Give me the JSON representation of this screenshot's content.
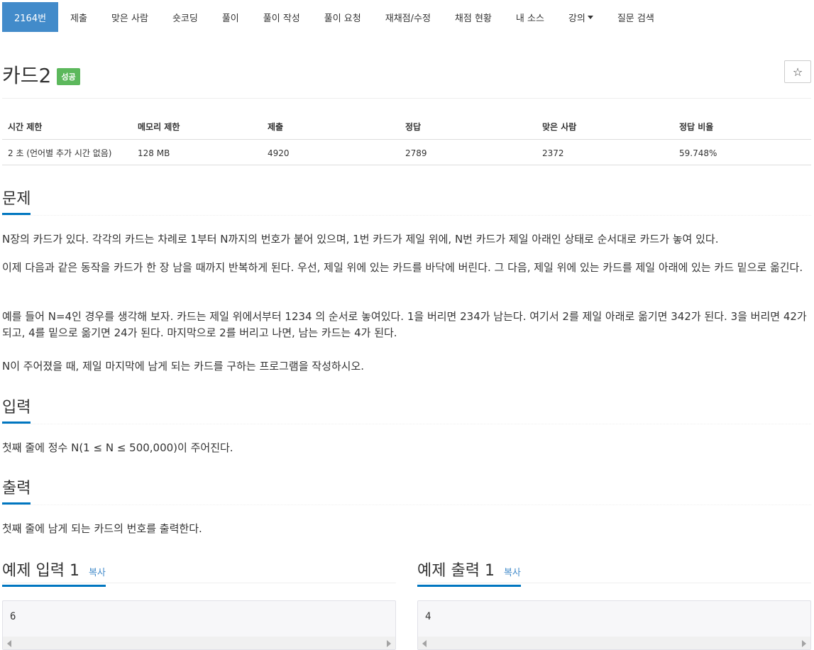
{
  "nav": [
    {
      "label": "2164번",
      "active": true
    },
    {
      "label": "제출"
    },
    {
      "label": "맞은 사람"
    },
    {
      "label": "숏코딩"
    },
    {
      "label": "풀이"
    },
    {
      "label": "풀이 작성"
    },
    {
      "label": "풀이 요청"
    },
    {
      "label": "재채점/수정"
    },
    {
      "label": "채점 현황"
    },
    {
      "label": "내 소스"
    },
    {
      "label": "강의"
    },
    {
      "label": "질문 검색"
    }
  ],
  "problem": {
    "title": "카드2",
    "status_badge": "성공",
    "star_icon": "☆"
  },
  "info": {
    "headers": [
      "시간 제한",
      "메모리 제한",
      "제출",
      "정답",
      "맞은 사람",
      "정답 비율"
    ],
    "values": [
      "2 초 (언어별 추가 시간 없음)",
      "128 MB",
      "4920",
      "2789",
      "2372",
      "59.748%"
    ]
  },
  "sections": {
    "description_title": "문제",
    "description": [
      "N장의 카드가 있다. 각각의 카드는 차례로 1부터 N까지의 번호가 붙어 있으며, 1번 카드가 제일 위에, N번 카드가 제일 아래인 상태로 순서대로 카드가 놓여 있다.",
      "이제 다음과 같은 동작을 카드가 한 장 남을 때까지 반복하게 된다. 우선, 제일 위에 있는 카드를 바닥에 버린다. 그 다음, 제일 위에 있는 카드를 제일 아래에 있는 카드 밑으로 옮긴다.",
      "예를 들어 N=4인 경우를 생각해 보자. 카드는 제일 위에서부터 1234 의 순서로 놓여있다. 1을 버리면 234가 남는다. 여기서 2를 제일 아래로 옮기면 342가 된다. 3을 버리면 42가 되고, 4를 밑으로 옮기면 24가 된다. 마지막으로 2를 버리고 나면, 남는 카드는 4가 된다.",
      "N이 주어졌을 때, 제일 마지막에 남게 되는 카드를 구하는 프로그램을 작성하시오."
    ],
    "input_title": "입력",
    "input": "첫째 줄에 정수 N(1 ≤ N ≤ 500,000)이 주어진다.",
    "output_title": "출력",
    "output": "첫째 줄에 남게 되는 카드의 번호를 출력한다."
  },
  "samples": {
    "input_title": "예제 입력 1",
    "output_title": "예제 출력 1",
    "copy_label": "복사",
    "input_value": "6",
    "output_value": "4"
  }
}
